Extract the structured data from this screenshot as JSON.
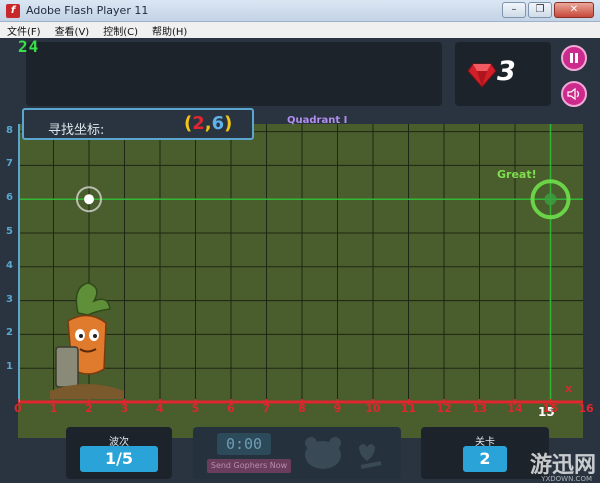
{
  "window": {
    "title": "Adobe Flash Player 11",
    "minimize": "–",
    "restore": "❐",
    "close": "✕"
  },
  "menu": [
    "文件(F)",
    "查看(V)",
    "控制(C)",
    "帮助(H)"
  ],
  "game": {
    "score": "24",
    "gems": "3",
    "prompt_label": "寻找坐标:",
    "target": {
      "open": "(",
      "x": "2",
      "comma": ",",
      "y": "6",
      "close": ")"
    },
    "quadrant_label": "Quadrant I",
    "feedback": "Great!",
    "x_axis_letter": "x",
    "x_ticks": [
      "0",
      "1",
      "2",
      "3",
      "4",
      "5",
      "6",
      "7",
      "8",
      "9",
      "10",
      "11",
      "12",
      "13",
      "14",
      "15",
      "16"
    ],
    "y_ticks": [
      "1",
      "2",
      "3",
      "4",
      "5",
      "6",
      "7",
      "8"
    ],
    "highlight_x": "15",
    "player_position": {
      "x": 2,
      "y": 6
    },
    "hit_position": {
      "x": 15,
      "y": 6
    },
    "hud": {
      "waves_label": "波次",
      "waves_value": "1/5",
      "timer": "0:00",
      "send_button": "Send Gophers Now",
      "level_label": "关卡",
      "level_value": "2"
    },
    "watermark": "游迅网",
    "watermark_sub": "YXDOWN.COM",
    "colors": {
      "grass": "#4a5d2c",
      "grid_line": "#1e2615",
      "x_axis": "#e0262e",
      "y_axis": "#5aa6cf",
      "crosshair": "#34c43a",
      "accent_pink": "#cc2a8c",
      "hud_blue": "#2aa3d9"
    }
  }
}
